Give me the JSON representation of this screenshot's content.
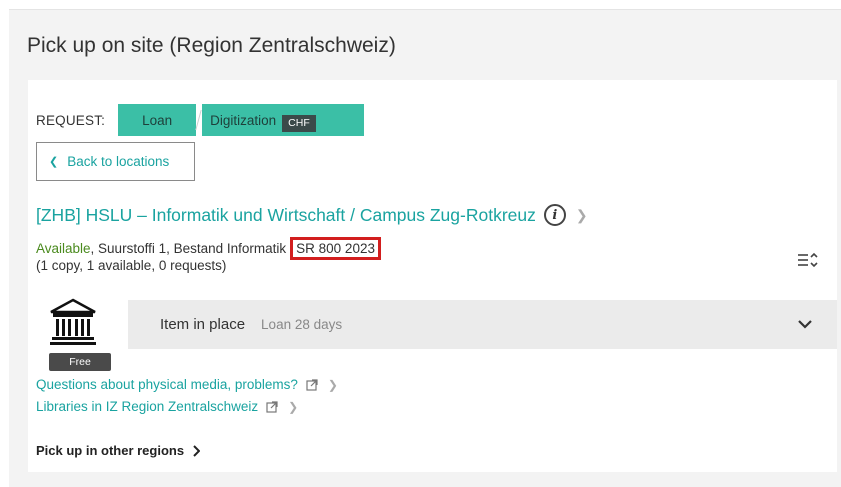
{
  "panel": {
    "title": "Pick up on site (Region Zentralschweiz)"
  },
  "request": {
    "label": "REQUEST:",
    "loan_label": "Loan",
    "digitization_label": "Digitization",
    "digitization_badge": "CHF"
  },
  "back_button": {
    "label": "Back to locations"
  },
  "location": {
    "title": "[ZHB] HSLU – Informatik und Wirtschaft / Campus Zug-Rotkreuz",
    "status": "Available",
    "details": ", Suurstoffi 1, Bestand Informatik",
    "call_number": "SR 800 2023",
    "counts": "(1 copy, 1 available, 0 requests)"
  },
  "item": {
    "label": "Item in place",
    "policy": "Loan 28 days",
    "fee_badge": "Free"
  },
  "links": [
    {
      "label": "Questions about physical media, problems?"
    },
    {
      "label": "Libraries in IZ Region Zentralschweiz"
    }
  ],
  "other_regions": {
    "label": "Pick up in other regions"
  },
  "colors": {
    "accent_teal": "#1aa3a0",
    "button_teal": "#3bbfa6",
    "available_green": "#4a8a1e",
    "highlight_red": "#d21e1e"
  }
}
